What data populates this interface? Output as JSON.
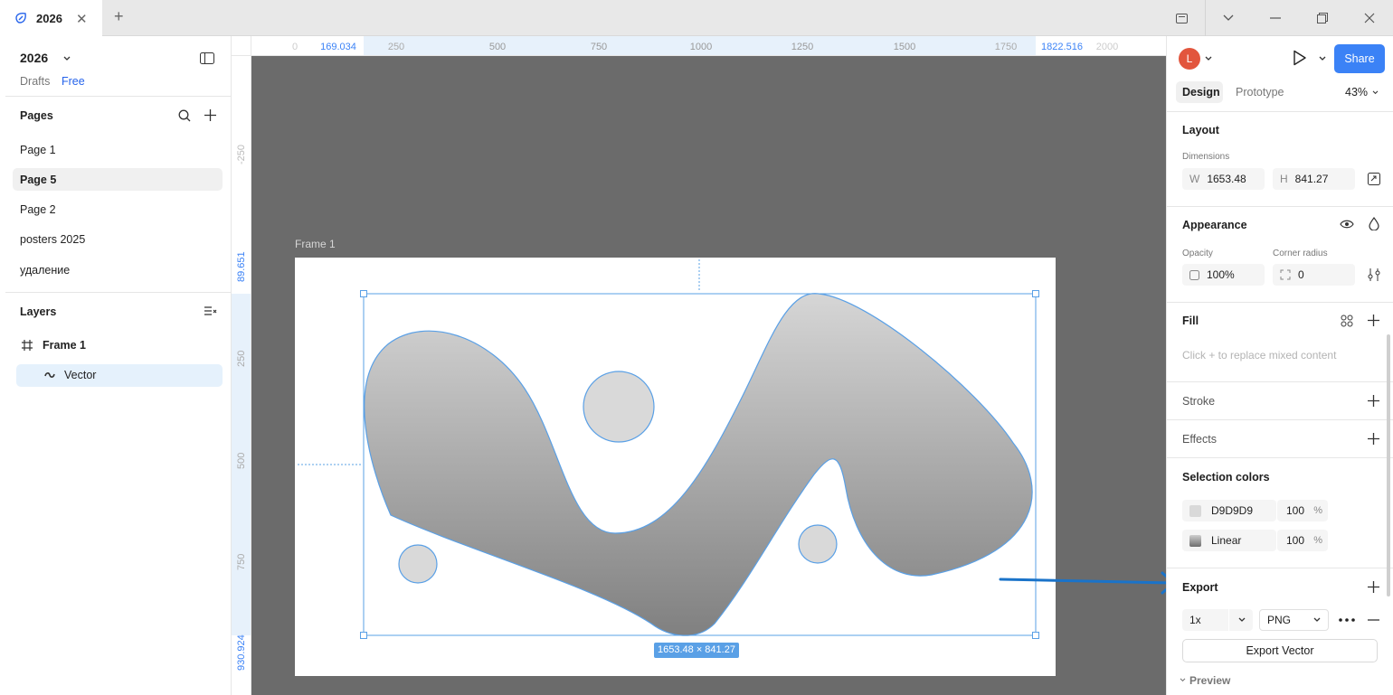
{
  "tab": {
    "title": "2026"
  },
  "file": {
    "name": "2026",
    "location": "Drafts",
    "plan": "Free"
  },
  "pages": {
    "header": "Pages",
    "items": [
      "Page 1",
      "Page 5",
      "Page 2",
      "posters 2025",
      "удаление"
    ],
    "selected": "Page 5"
  },
  "layers": {
    "header": "Layers",
    "items": [
      {
        "name": "Frame 1",
        "icon": "frame-icon"
      },
      {
        "name": "Vector",
        "icon": "vector-icon"
      }
    ]
  },
  "ruler": {
    "top": [
      "0",
      "169.034",
      "250",
      "500",
      "750",
      "1000",
      "1250",
      "1500",
      "1750",
      "1822.516",
      "2000"
    ],
    "left": [
      "-250",
      "89.651",
      "250",
      "500",
      "750",
      "930.924"
    ]
  },
  "canvas": {
    "frame_label": "Frame 1",
    "size_badge": "1653.48 × 841.27"
  },
  "right": {
    "avatar": "L",
    "share": "Share",
    "tabs": [
      "Design",
      "Prototype"
    ],
    "zoom": "43%",
    "layout": {
      "title": "Layout",
      "dimensions_label": "Dimensions",
      "w_label": "W",
      "w": "1653.48",
      "h_label": "H",
      "h": "841.27"
    },
    "appearance": {
      "title": "Appearance",
      "opacity_label": "Opacity",
      "opacity": "100%",
      "radius_label": "Corner radius",
      "radius": "0"
    },
    "fill": {
      "title": "Fill",
      "hint": "Click + to replace mixed content"
    },
    "stroke": "Stroke",
    "effects": "Effects",
    "selection_colors": {
      "title": "Selection colors",
      "items": [
        {
          "name": "D9D9D9",
          "opacity": "100",
          "unit": "%",
          "swatch": "#D9D9D9"
        },
        {
          "name": "Linear",
          "opacity": "100",
          "unit": "%",
          "swatch": "#888888"
        }
      ]
    },
    "export": {
      "title": "Export",
      "scale": "1x",
      "format": "PNG",
      "button": "Export Vector",
      "preview": "Preview"
    }
  },
  "colors": {
    "accent": "#0d99ff",
    "share_bg": "#3b82f6",
    "avatar_bg": "#e2553d",
    "selection": "#5aa0e6"
  }
}
